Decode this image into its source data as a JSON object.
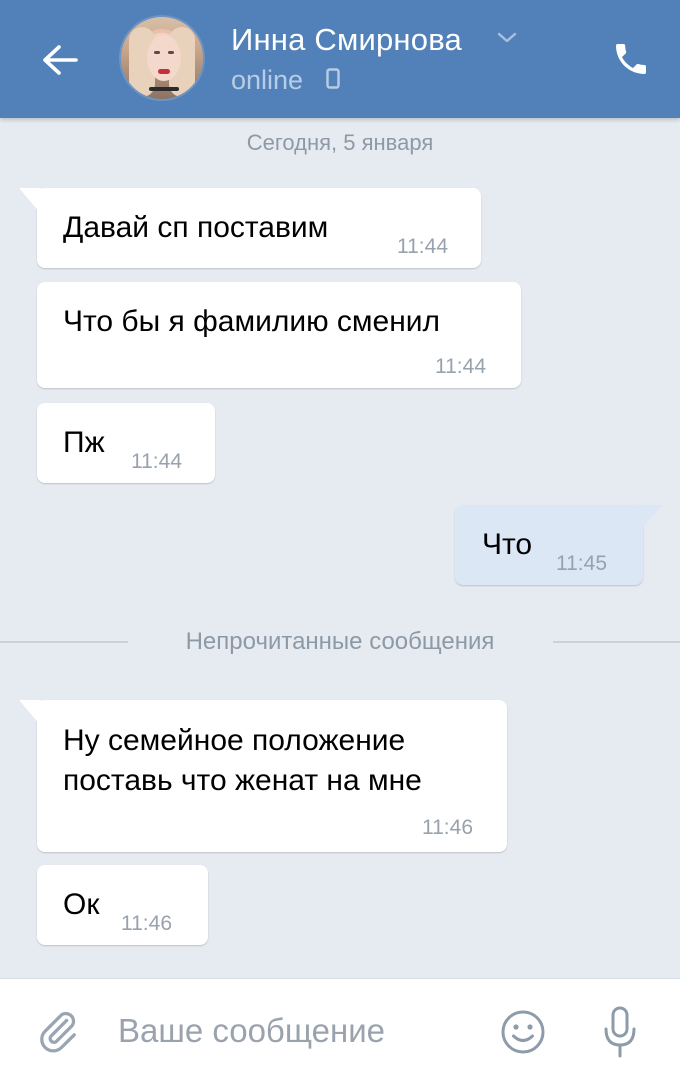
{
  "header": {
    "contact_name": "Инна Смирнова",
    "status": "online",
    "icons": {
      "back": "arrow-left-icon",
      "chevron": "chevron-down-icon",
      "device": "mobile-phone-icon",
      "call": "phone-icon"
    },
    "colors": {
      "background": "#5181b8",
      "status": "#b9cce6"
    }
  },
  "chat": {
    "date_separator": "Сегодня, 5 января",
    "unread_separator": "Непрочитанные сообщения",
    "messages": [
      {
        "direction": "incoming",
        "text": "Давай сп поставим",
        "time": "11:44"
      },
      {
        "direction": "incoming",
        "text": "Что бы я фамилию сменил",
        "time": "11:44"
      },
      {
        "direction": "incoming",
        "text": "Пж",
        "time": "11:44"
      },
      {
        "direction": "outgoing",
        "text": "Что",
        "time": "11:45"
      },
      {
        "direction": "incoming",
        "text": "Ну семейное положение\nпоставь что женат на мне",
        "time": "11:46"
      },
      {
        "direction": "incoming",
        "text": "Ок",
        "time": "11:46"
      }
    ],
    "colors": {
      "background": "#e6ebf1",
      "incoming_bubble": "#ffffff",
      "outgoing_bubble": "#dbe7f5"
    }
  },
  "composer": {
    "placeholder": "Ваше сообщение",
    "value": "",
    "icons": {
      "attach": "paperclip-icon",
      "emoji": "smiley-icon",
      "voice": "microphone-icon"
    }
  }
}
